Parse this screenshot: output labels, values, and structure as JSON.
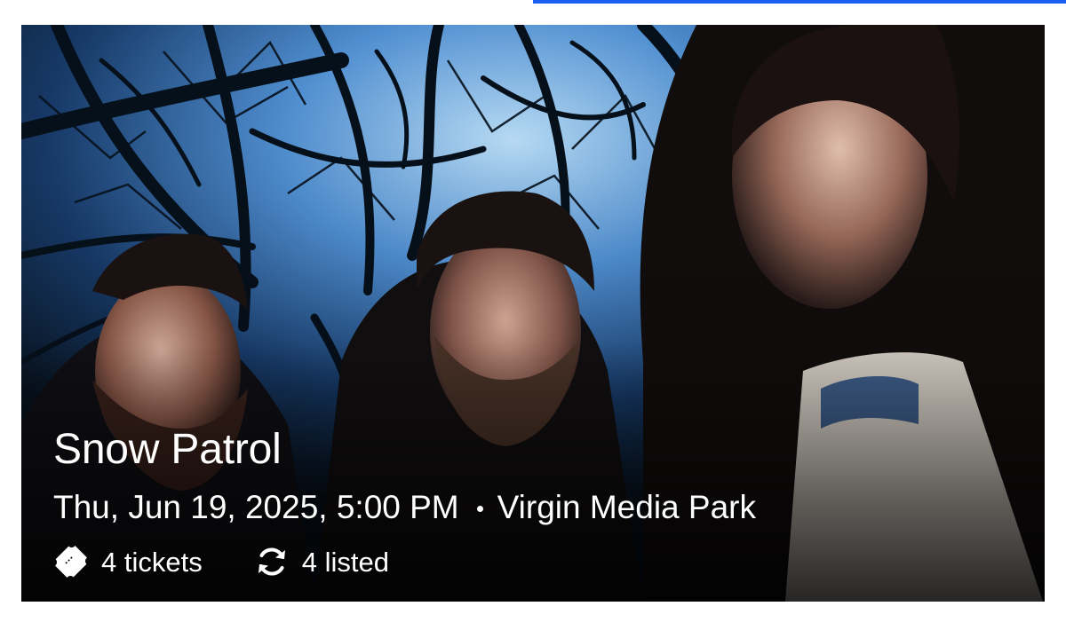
{
  "event": {
    "artist": "Snow Patrol",
    "date_time": "Thu, Jun 19, 2025, 5:00 PM",
    "venue": "Virgin Media Park",
    "tickets": "4 tickets",
    "listed": "4 listed"
  },
  "icons": {
    "ticket": "ticket-icon",
    "listed": "refresh-icon"
  },
  "colors": {
    "accent": "#1a5ff2",
    "caption_text": "#ffffff"
  }
}
